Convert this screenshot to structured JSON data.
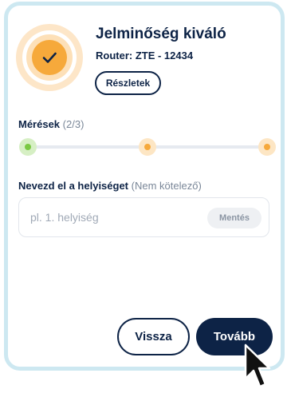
{
  "header": {
    "title": "Jelminőség kiváló",
    "router": "Router: ZTE - 12434",
    "details_label": "Részletek",
    "status_icon": "check-icon"
  },
  "measurements": {
    "label": "Mérések",
    "count": "(2/3)",
    "steps": [
      {
        "state": "done",
        "color": "#7ac943"
      },
      {
        "state": "pending",
        "color": "#f6a93b"
      },
      {
        "state": "pending",
        "color": "#f6a93b"
      }
    ]
  },
  "location": {
    "label": "Nevezd el a helyiséget",
    "optional_note": "(Nem kötelező)",
    "placeholder": "pl. 1. helyiség",
    "value": "",
    "save_label": "Mentés"
  },
  "footer": {
    "back_label": "Vissza",
    "next_label": "Tovább"
  },
  "colors": {
    "primary": "#0d2346",
    "accent": "#f6a93b",
    "success": "#7ac943",
    "frame": "#cde8f1"
  }
}
